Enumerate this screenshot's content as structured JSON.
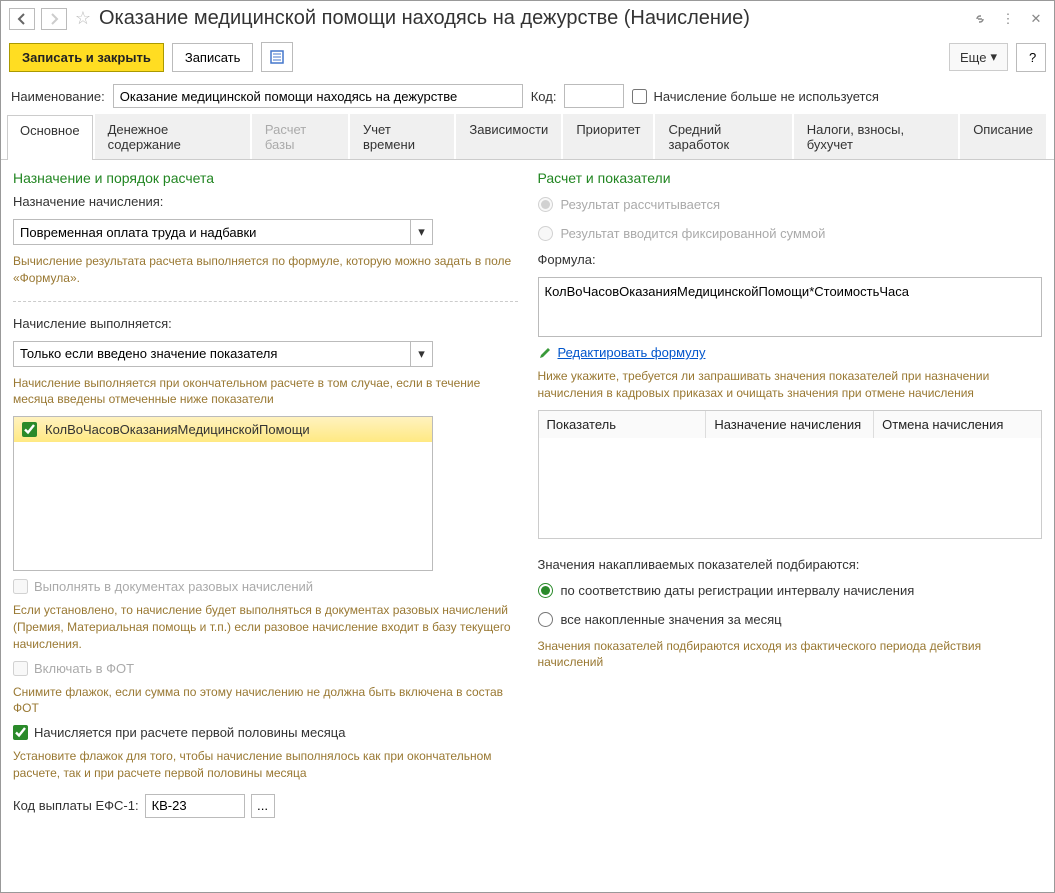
{
  "titlebar": {
    "title": "Оказание медицинской помощи находясь на дежурстве (Начисление)"
  },
  "toolbar": {
    "save_close": "Записать и закрыть",
    "save": "Записать",
    "more": "Еще",
    "help": "?"
  },
  "header": {
    "name_label": "Наименование:",
    "name_value": "Оказание медицинской помощи находясь на дежурстве",
    "code_label": "Код:",
    "code_value": "",
    "not_used_label": "Начисление больше не используется"
  },
  "tabs": [
    "Основное",
    "Денежное содержание",
    "Расчет базы",
    "Учет времени",
    "Зависимости",
    "Приоритет",
    "Средний заработок",
    "Налоги, взносы, бухучет",
    "Описание"
  ],
  "left": {
    "section1": "Назначение и порядок расчета",
    "purpose_label": "Назначение начисления:",
    "purpose_value": "Повременная оплата труда и надбавки",
    "purpose_hint": "Вычисление результата расчета выполняется по формуле, которую можно задать в поле «Формула».",
    "exec_label": "Начисление выполняется:",
    "exec_value": "Только если введено значение показателя",
    "exec_hint": "Начисление выполняется при окончательном расчете в том случае, если в течение месяца введены отмеченные ниже показатели",
    "indicator": "КолВоЧасовОказанияМедицинскойПомощи",
    "once_label": "Выполнять в документах разовых начислений",
    "once_hint": "Если установлено, то начисление будет выполняться в документах разовых начислений (Премия, Материальная помощь и т.п.) если разовое начисление входит в базу текущего начисления.",
    "fot_label": "Включать в ФОТ",
    "fot_hint": "Снимите флажок, если сумма по этому начислению не должна быть включена в состав ФОТ",
    "half_label": "Начисляется при расчете первой половины месяца",
    "half_hint": "Установите флажок для того, чтобы начисление выполнялось как при окончательном расчете, так и при расчете первой половины месяца",
    "efs_label": "Код выплаты ЕФС-1:",
    "efs_value": "КВ-23"
  },
  "right": {
    "section2": "Расчет и показатели",
    "radio_calc": "Результат рассчитывается",
    "radio_fixed": "Результат вводится фиксированной суммой",
    "formula_label": "Формула:",
    "formula_value": "КолВоЧасовОказанияМедицинскойПомощи*СтоимостьЧаса",
    "edit_formula": "Редактировать формулу",
    "table_hint": "Ниже укажите, требуется ли запрашивать значения показателей при назначении начисления в кадровых приказах и очищать значения при отмене начисления",
    "th1": "Показатель",
    "th2": "Назначение начисления",
    "th3": "Отмена начисления",
    "accum_label": "Значения накапливаемых показателей подбираются:",
    "accum_r1": "по соответствию даты регистрации интервалу начисления",
    "accum_r2": "все накопленные значения за месяц",
    "accum_hint": "Значения показателей подбираются исходя из фактического периода действия начислений"
  }
}
